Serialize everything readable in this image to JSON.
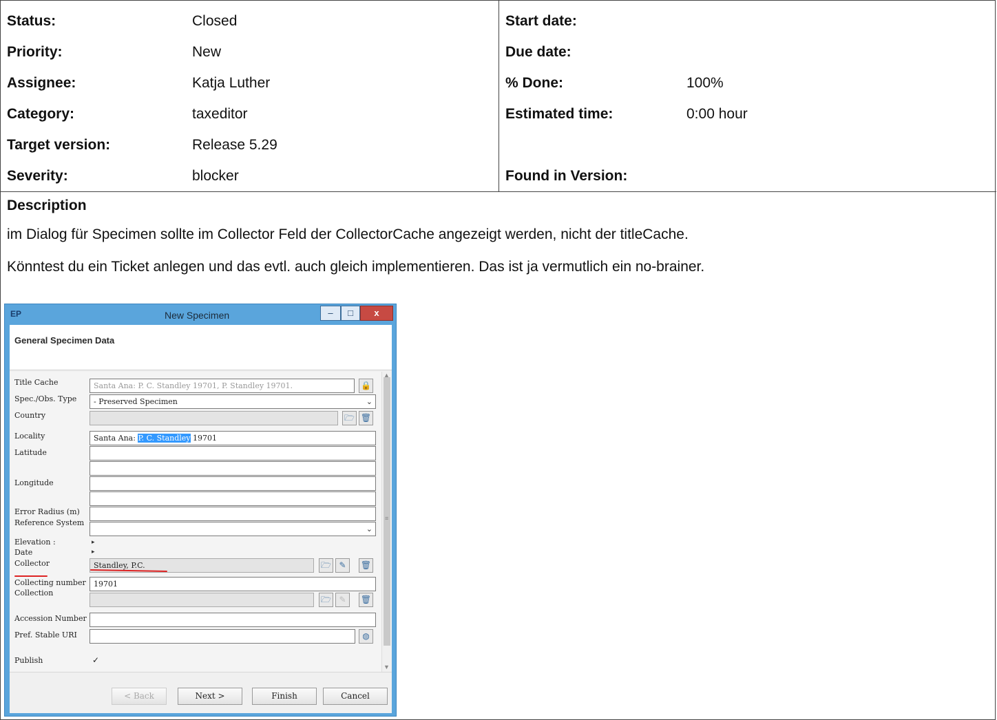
{
  "attributes_left": [
    {
      "label": "Status:",
      "value": "Closed"
    },
    {
      "label": "Priority:",
      "value": "New"
    },
    {
      "label": "Assignee:",
      "value": "Katja Luther"
    },
    {
      "label": "Category:",
      "value": "taxeditor"
    },
    {
      "label": "Target version:",
      "value": "Release 5.29"
    },
    {
      "label": "Severity:",
      "value": "blocker"
    }
  ],
  "attributes_right": [
    {
      "label": "Start date:",
      "value": ""
    },
    {
      "label": "Due date:",
      "value": ""
    },
    {
      "label": "% Done:",
      "value": "100%"
    },
    {
      "label": "Estimated time:",
      "value": "0:00 hour"
    },
    {
      "label": "",
      "value": ""
    },
    {
      "label": "Found in Version:",
      "value": ""
    }
  ],
  "description": {
    "title": "Description",
    "paragraphs": [
      "im Dialog für Specimen sollte im Collector Feld der CollectorCache angezeigt werden, nicht der titleCache.",
      "Könntest du ein Ticket anlegen und das evtl. auch gleich implementieren. Das ist ja vermutlich ein no-brainer."
    ]
  },
  "dialog": {
    "app_icon": "EP",
    "title": "New Specimen",
    "window_controls": {
      "minimize": "–",
      "maximize": "□",
      "close": "x"
    },
    "section_title": "General Specimen Data",
    "fields": {
      "title_cache": {
        "label": "Title Cache",
        "value": "Santa Ana: P. C. Standley 19701, P. Standley 19701."
      },
      "spec_type": {
        "label": "Spec./Obs. Type",
        "value": "- Preserved Specimen"
      },
      "country": {
        "label": "Country",
        "value": ""
      },
      "locality": {
        "label": "Locality",
        "value_before": "Santa Ana: ",
        "value_selected": "P. C. Standley",
        "value_after": " 19701"
      },
      "latitude": {
        "label": "Latitude"
      },
      "longitude": {
        "label": "Longitude"
      },
      "error_radius": {
        "label": "Error Radius (m)"
      },
      "reference_system": {
        "label": "Reference System"
      },
      "elevation": {
        "label": "Elevation :"
      },
      "date": {
        "label": "Date"
      },
      "collector": {
        "label": "Collector",
        "value": "Standley, P.C."
      },
      "collecting_number": {
        "label": "Collecting number",
        "value": "19701"
      },
      "collection": {
        "label": "Collection"
      },
      "accession_number": {
        "label": "Accession Number"
      },
      "stable_uri": {
        "label": "Pref. Stable URI"
      },
      "publish": {
        "label": "Publish",
        "checked": true
      }
    },
    "buttons": {
      "back": "< Back",
      "next": "Next >",
      "finish": "Finish",
      "cancel": "Cancel"
    }
  }
}
